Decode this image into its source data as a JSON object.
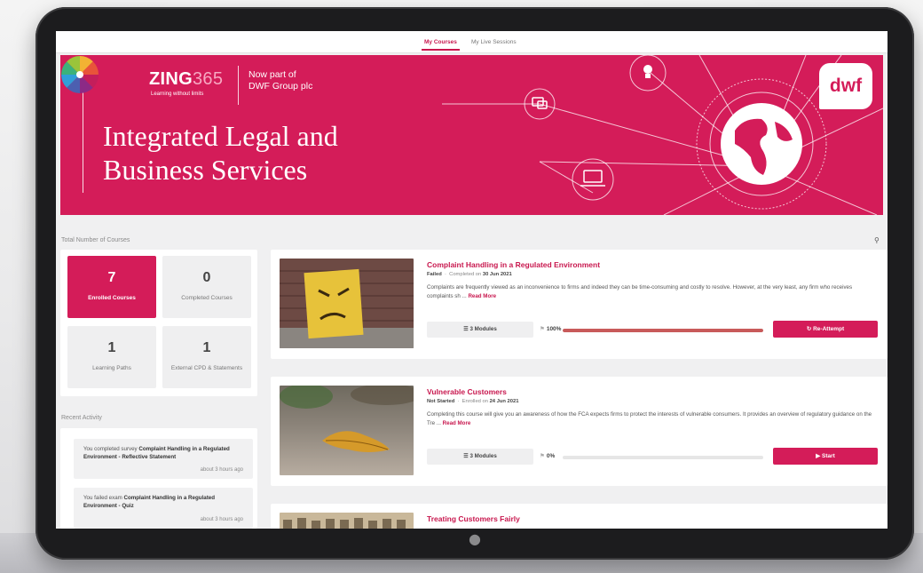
{
  "tabs": [
    {
      "label": "My Courses",
      "active": true
    },
    {
      "label": "My Live Sessions",
      "active": false
    }
  ],
  "banner": {
    "brand_main": "ZING",
    "brand_num": "365",
    "tagline": "Learning without limits",
    "partner_line1": "Now part of",
    "partner_line2": "DWF Group plc",
    "headline_line1": "Integrated Legal and",
    "headline_line2": "Business Services",
    "partner_logo": "dwf",
    "background_color": "#d41c59"
  },
  "stats_section": {
    "title": "Total Number of Courses",
    "items": [
      {
        "value": "7",
        "label": "Enrolled Courses",
        "highlighted": true
      },
      {
        "value": "0",
        "label": "Completed Courses",
        "highlighted": false
      },
      {
        "value": "1",
        "label": "Learning Paths",
        "highlighted": false
      },
      {
        "value": "1",
        "label": "External CPD & Statements",
        "highlighted": false
      }
    ]
  },
  "recent_activity": {
    "title": "Recent Activity",
    "items": [
      {
        "prefix": "You completed survey ",
        "subject": "Complaint Handling in a Regulated Environment - Reflective Statement",
        "time": "about 3 hours ago"
      },
      {
        "prefix": "You failed exam ",
        "subject": "Complaint Handling in a Regulated Environment - Quiz",
        "time": "about 3 hours ago"
      }
    ]
  },
  "courses": [
    {
      "title": "Complaint Handling in a Regulated Environment",
      "status": "Failed",
      "date_label": "Completed on",
      "date": "30 Jun 2021",
      "description": "Complaints are frequently viewed as an inconvenience to firms and indeed they can be time-consuming and costly to resolve. However, at the very least, any firm who receives complaints sh ...",
      "read_more": "Read More",
      "modules": "3 Modules",
      "progress_label": "100%",
      "progress": 1.0,
      "action": "Re-Attempt",
      "action_icon": "retry-icon"
    },
    {
      "title": "Vulnerable Customers",
      "status": "Not Started",
      "date_label": "Enrolled on",
      "date": "24 Jun 2021",
      "description": "Completing this course will give you an awareness of how the FCA expects firms to protect the interests of vulnerable consumers. It provides an overview of regulatory guidance on the Tre ...",
      "read_more": "Read More",
      "modules": "3 Modules",
      "progress_label": "0%",
      "progress": 0.0,
      "action": "Start",
      "action_icon": "play-icon"
    },
    {
      "title": "Treating Customers Fairly"
    }
  ],
  "icons": {
    "search": "search-icon",
    "modules": "list-icon",
    "progress": "flag-icon",
    "device_logo": "apple-icon"
  },
  "colors": {
    "accent": "#d41c59",
    "progress_fill": "#c85a5a"
  }
}
